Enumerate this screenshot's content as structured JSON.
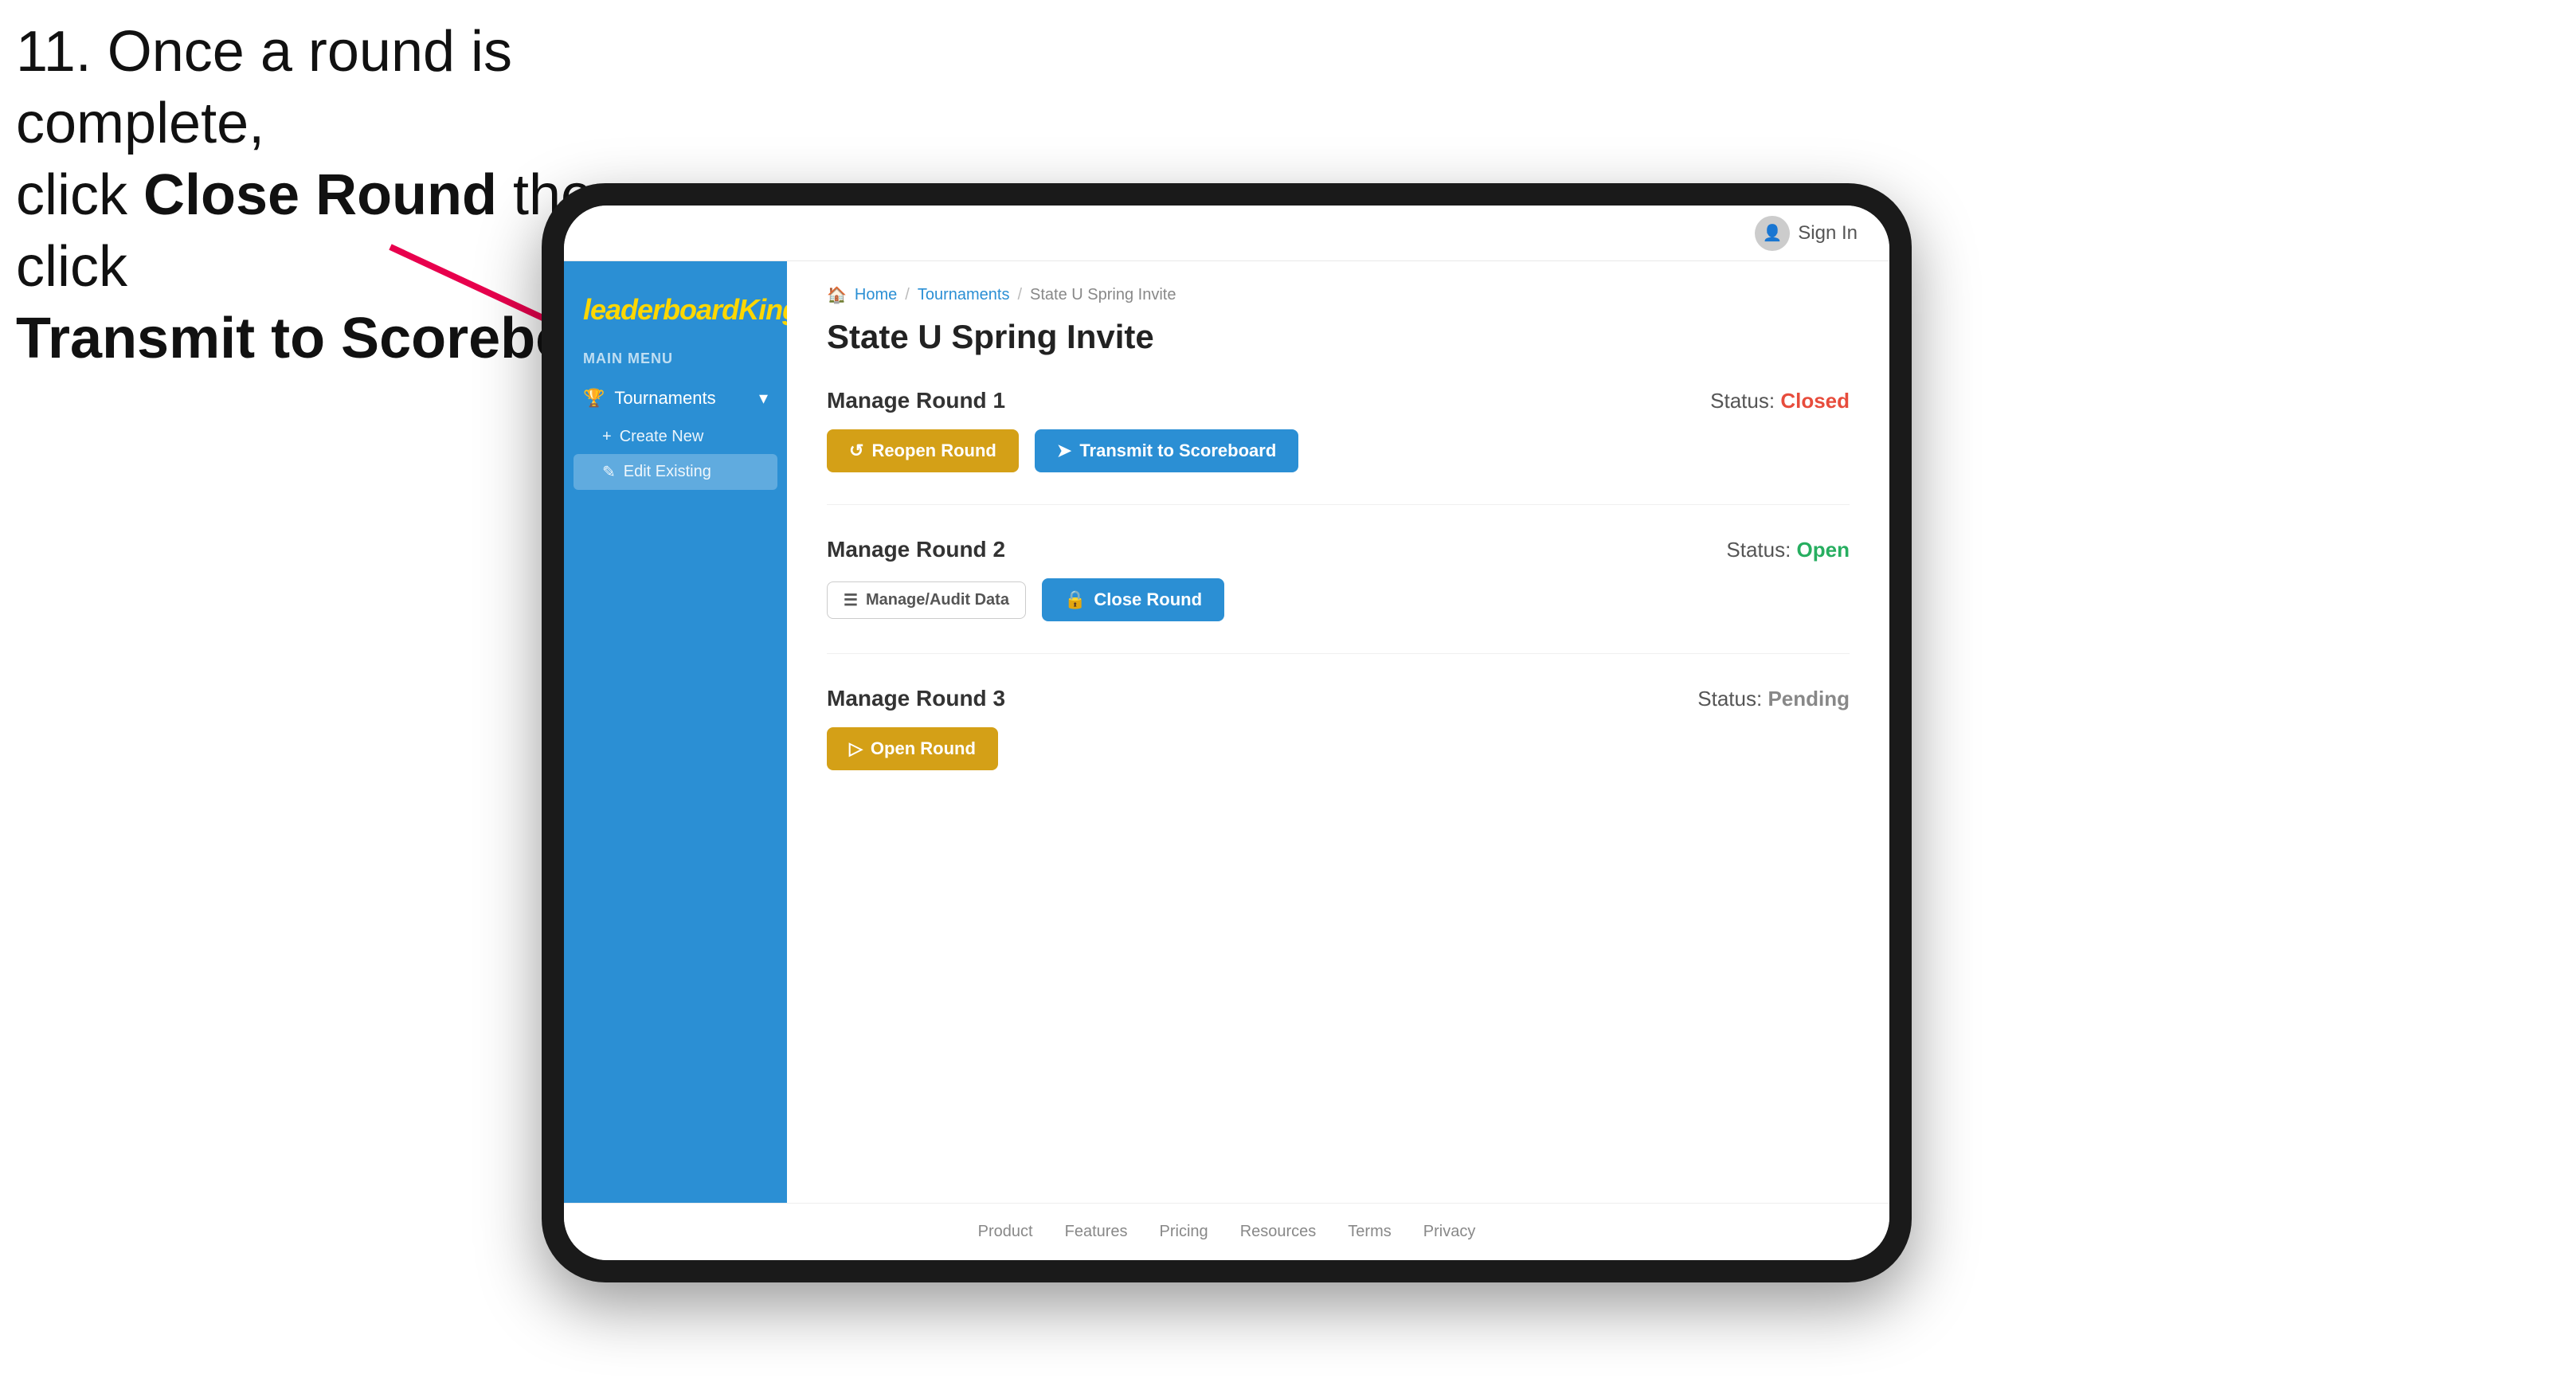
{
  "instruction": {
    "line1": "11. Once a round is complete,",
    "line2_prefix": "click ",
    "line2_bold": "Close Round",
    "line2_suffix": " then click",
    "line3_bold": "Transmit to Scoreboard."
  },
  "header": {
    "sign_in_label": "Sign In"
  },
  "logo": {
    "text_plain": "leaderboard",
    "text_styled": "King"
  },
  "sidebar": {
    "main_menu_label": "MAIN MENU",
    "tournaments_label": "Tournaments",
    "create_new_label": "Create New",
    "edit_existing_label": "Edit Existing"
  },
  "breadcrumb": {
    "home": "Home",
    "tournaments": "Tournaments",
    "current": "State U Spring Invite"
  },
  "page": {
    "title": "State U Spring Invite"
  },
  "rounds": [
    {
      "id": "round1",
      "title": "Manage Round 1",
      "status_label": "Status:",
      "status_value": "Closed",
      "status_class": "status-closed",
      "actions": [
        {
          "label": "Reopen Round",
          "style": "btn-gold",
          "icon": "↺"
        },
        {
          "label": "Transmit to Scoreboard",
          "style": "btn-blue",
          "icon": "➤"
        }
      ]
    },
    {
      "id": "round2",
      "title": "Manage Round 2",
      "status_label": "Status:",
      "status_value": "Open",
      "status_class": "status-open",
      "actions": [
        {
          "label": "Manage/Audit Data",
          "style": "btn-outline",
          "icon": "☰"
        },
        {
          "label": "Close Round",
          "style": "btn-blue",
          "icon": "🔒"
        }
      ]
    },
    {
      "id": "round3",
      "title": "Manage Round 3",
      "status_label": "Status:",
      "status_value": "Pending",
      "status_class": "status-pending",
      "actions": [
        {
          "label": "Open Round",
          "style": "btn-gold",
          "icon": "▷"
        }
      ]
    }
  ],
  "footer": {
    "links": [
      "Product",
      "Features",
      "Pricing",
      "Resources",
      "Terms",
      "Privacy"
    ]
  }
}
